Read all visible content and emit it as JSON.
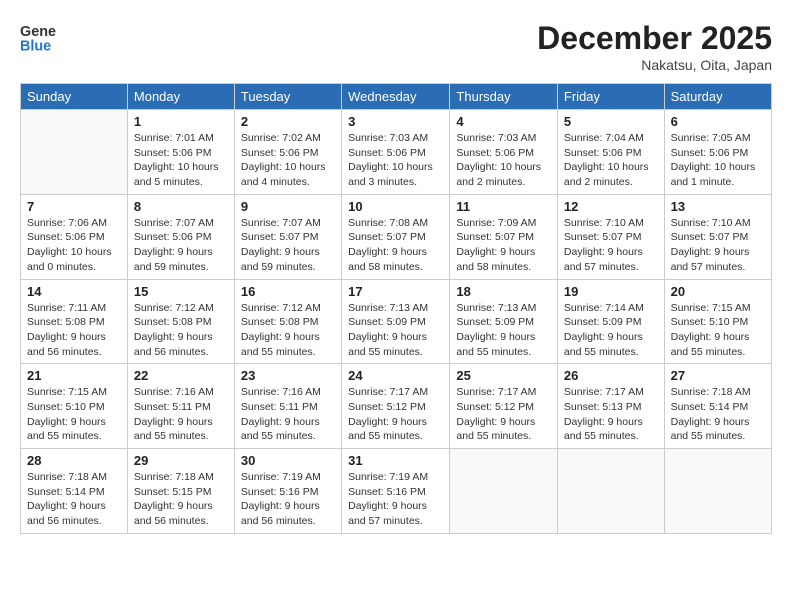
{
  "header": {
    "logo_line1": "General",
    "logo_line2": "Blue",
    "month": "December 2025",
    "location": "Nakatsu, Oita, Japan"
  },
  "weekdays": [
    "Sunday",
    "Monday",
    "Tuesday",
    "Wednesday",
    "Thursday",
    "Friday",
    "Saturday"
  ],
  "weeks": [
    [
      {
        "day": "",
        "info": ""
      },
      {
        "day": "1",
        "info": "Sunrise: 7:01 AM\nSunset: 5:06 PM\nDaylight: 10 hours\nand 5 minutes."
      },
      {
        "day": "2",
        "info": "Sunrise: 7:02 AM\nSunset: 5:06 PM\nDaylight: 10 hours\nand 4 minutes."
      },
      {
        "day": "3",
        "info": "Sunrise: 7:03 AM\nSunset: 5:06 PM\nDaylight: 10 hours\nand 3 minutes."
      },
      {
        "day": "4",
        "info": "Sunrise: 7:03 AM\nSunset: 5:06 PM\nDaylight: 10 hours\nand 2 minutes."
      },
      {
        "day": "5",
        "info": "Sunrise: 7:04 AM\nSunset: 5:06 PM\nDaylight: 10 hours\nand 2 minutes."
      },
      {
        "day": "6",
        "info": "Sunrise: 7:05 AM\nSunset: 5:06 PM\nDaylight: 10 hours\nand 1 minute."
      }
    ],
    [
      {
        "day": "7",
        "info": "Sunrise: 7:06 AM\nSunset: 5:06 PM\nDaylight: 10 hours\nand 0 minutes."
      },
      {
        "day": "8",
        "info": "Sunrise: 7:07 AM\nSunset: 5:06 PM\nDaylight: 9 hours\nand 59 minutes."
      },
      {
        "day": "9",
        "info": "Sunrise: 7:07 AM\nSunset: 5:07 PM\nDaylight: 9 hours\nand 59 minutes."
      },
      {
        "day": "10",
        "info": "Sunrise: 7:08 AM\nSunset: 5:07 PM\nDaylight: 9 hours\nand 58 minutes."
      },
      {
        "day": "11",
        "info": "Sunrise: 7:09 AM\nSunset: 5:07 PM\nDaylight: 9 hours\nand 58 minutes."
      },
      {
        "day": "12",
        "info": "Sunrise: 7:10 AM\nSunset: 5:07 PM\nDaylight: 9 hours\nand 57 minutes."
      },
      {
        "day": "13",
        "info": "Sunrise: 7:10 AM\nSunset: 5:07 PM\nDaylight: 9 hours\nand 57 minutes."
      }
    ],
    [
      {
        "day": "14",
        "info": "Sunrise: 7:11 AM\nSunset: 5:08 PM\nDaylight: 9 hours\nand 56 minutes."
      },
      {
        "day": "15",
        "info": "Sunrise: 7:12 AM\nSunset: 5:08 PM\nDaylight: 9 hours\nand 56 minutes."
      },
      {
        "day": "16",
        "info": "Sunrise: 7:12 AM\nSunset: 5:08 PM\nDaylight: 9 hours\nand 55 minutes."
      },
      {
        "day": "17",
        "info": "Sunrise: 7:13 AM\nSunset: 5:09 PM\nDaylight: 9 hours\nand 55 minutes."
      },
      {
        "day": "18",
        "info": "Sunrise: 7:13 AM\nSunset: 5:09 PM\nDaylight: 9 hours\nand 55 minutes."
      },
      {
        "day": "19",
        "info": "Sunrise: 7:14 AM\nSunset: 5:09 PM\nDaylight: 9 hours\nand 55 minutes."
      },
      {
        "day": "20",
        "info": "Sunrise: 7:15 AM\nSunset: 5:10 PM\nDaylight: 9 hours\nand 55 minutes."
      }
    ],
    [
      {
        "day": "21",
        "info": "Sunrise: 7:15 AM\nSunset: 5:10 PM\nDaylight: 9 hours\nand 55 minutes."
      },
      {
        "day": "22",
        "info": "Sunrise: 7:16 AM\nSunset: 5:11 PM\nDaylight: 9 hours\nand 55 minutes."
      },
      {
        "day": "23",
        "info": "Sunrise: 7:16 AM\nSunset: 5:11 PM\nDaylight: 9 hours\nand 55 minutes."
      },
      {
        "day": "24",
        "info": "Sunrise: 7:17 AM\nSunset: 5:12 PM\nDaylight: 9 hours\nand 55 minutes."
      },
      {
        "day": "25",
        "info": "Sunrise: 7:17 AM\nSunset: 5:12 PM\nDaylight: 9 hours\nand 55 minutes."
      },
      {
        "day": "26",
        "info": "Sunrise: 7:17 AM\nSunset: 5:13 PM\nDaylight: 9 hours\nand 55 minutes."
      },
      {
        "day": "27",
        "info": "Sunrise: 7:18 AM\nSunset: 5:14 PM\nDaylight: 9 hours\nand 55 minutes."
      }
    ],
    [
      {
        "day": "28",
        "info": "Sunrise: 7:18 AM\nSunset: 5:14 PM\nDaylight: 9 hours\nand 56 minutes."
      },
      {
        "day": "29",
        "info": "Sunrise: 7:18 AM\nSunset: 5:15 PM\nDaylight: 9 hours\nand 56 minutes."
      },
      {
        "day": "30",
        "info": "Sunrise: 7:19 AM\nSunset: 5:16 PM\nDaylight: 9 hours\nand 56 minutes."
      },
      {
        "day": "31",
        "info": "Sunrise: 7:19 AM\nSunset: 5:16 PM\nDaylight: 9 hours\nand 57 minutes."
      },
      {
        "day": "",
        "info": ""
      },
      {
        "day": "",
        "info": ""
      },
      {
        "day": "",
        "info": ""
      }
    ]
  ]
}
